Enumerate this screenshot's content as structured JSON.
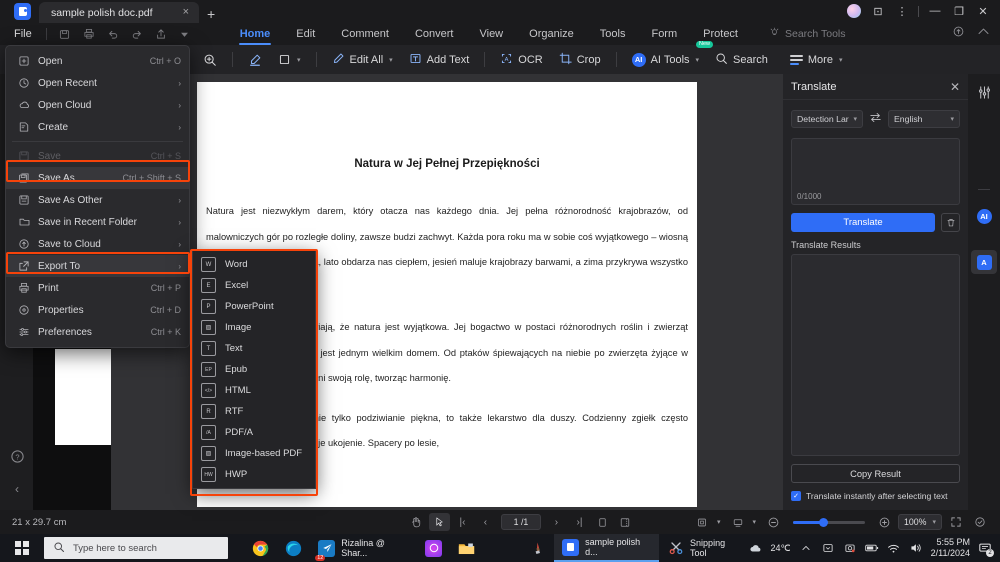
{
  "titlebar": {
    "tab_label": "sample polish doc.pdf",
    "close_icon": "×",
    "new_tab_icon": "+",
    "screen_icon": "⊡",
    "more_icon": "⋮",
    "minimize_icon": "—",
    "maximize_icon": "❐",
    "window_close_icon": "✕"
  },
  "menubar": {
    "file_label": "File",
    "quick_icons": [
      "save-icon",
      "print-icon",
      "undo-icon",
      "redo-icon",
      "share-icon",
      "chevron-down-icon"
    ],
    "tabs": [
      {
        "label": "Home",
        "active": true
      },
      {
        "label": "Edit",
        "active": false
      },
      {
        "label": "Comment",
        "active": false
      },
      {
        "label": "Convert",
        "active": false
      },
      {
        "label": "View",
        "active": false
      },
      {
        "label": "Organize",
        "active": false
      },
      {
        "label": "Tools",
        "active": false
      },
      {
        "label": "Form",
        "active": false
      },
      {
        "label": "Protect",
        "active": false
      }
    ],
    "search_tools_label": "Search Tools",
    "search_tools_icon": "bulb-icon",
    "right_icons": [
      "cloud-upload-icon",
      "collapse-ribbon-icon"
    ]
  },
  "toolbar": {
    "zoom_select_icon": "magnifier-plus-icon",
    "highlight_icon": "highlight-icon",
    "shape_icon": "square-icon",
    "edit_all_label": "Edit All",
    "add_text_label": "Add Text",
    "ocr_label": "OCR",
    "crop_label": "Crop",
    "ai_tools_label": "AI Tools",
    "ai_tools_badge": "New",
    "ai_badge_letters": "AI",
    "search_label": "Search",
    "more_label": "More"
  },
  "file_menu": {
    "items": [
      {
        "label": "Open",
        "accel": "Ctrl + O",
        "icon": "plus-box-icon",
        "arrow": false,
        "disabled": false,
        "highlight": false
      },
      {
        "label": "Open Recent",
        "accel": "",
        "icon": "clock-icon",
        "arrow": true,
        "disabled": false,
        "highlight": false
      },
      {
        "label": "Open Cloud",
        "accel": "",
        "icon": "cloud-icon",
        "arrow": true,
        "disabled": false,
        "highlight": false
      },
      {
        "label": "Create",
        "accel": "",
        "icon": "create-doc-icon",
        "arrow": true,
        "disabled": false,
        "highlight": false
      },
      {
        "label": "Save",
        "accel": "Ctrl + S",
        "icon": "floppy-icon",
        "arrow": false,
        "disabled": true,
        "highlight": false
      },
      {
        "label": "Save As",
        "accel": "Ctrl + Shift + S",
        "icon": "save-as-icon",
        "arrow": false,
        "disabled": false,
        "highlight": true
      },
      {
        "label": "Save As Other",
        "accel": "",
        "icon": "floppy-stack-icon",
        "arrow": true,
        "disabled": false,
        "highlight": false
      },
      {
        "label": "Save in Recent Folder",
        "accel": "",
        "icon": "folder-icon",
        "arrow": true,
        "disabled": false,
        "highlight": false
      },
      {
        "label": "Save to Cloud",
        "accel": "",
        "icon": "cloud-upload-icon",
        "arrow": true,
        "disabled": false,
        "highlight": false
      },
      {
        "label": "Export To",
        "accel": "",
        "icon": "export-icon",
        "arrow": true,
        "disabled": false,
        "highlight": true
      },
      {
        "label": "Print",
        "accel": "Ctrl + P",
        "icon": "printer-icon",
        "arrow": false,
        "disabled": false,
        "highlight": false
      },
      {
        "label": "Properties",
        "accel": "Ctrl + D",
        "icon": "info-circle-icon",
        "arrow": false,
        "disabled": false,
        "highlight": false
      },
      {
        "label": "Preferences",
        "accel": "Ctrl + K",
        "icon": "sliders-icon",
        "arrow": false,
        "disabled": false,
        "highlight": false
      }
    ]
  },
  "export_submenu": {
    "items": [
      {
        "label": "Word",
        "icon": "word-file-icon",
        "glyph": "W"
      },
      {
        "label": "Excel",
        "icon": "excel-file-icon",
        "glyph": "E"
      },
      {
        "label": "PowerPoint",
        "icon": "powerpoint-file-icon",
        "glyph": "P"
      },
      {
        "label": "Image",
        "icon": "image-file-icon",
        "glyph": "▨"
      },
      {
        "label": "Text",
        "icon": "text-file-icon",
        "glyph": "T"
      },
      {
        "label": "Epub",
        "icon": "epub-file-icon",
        "glyph": "EP"
      },
      {
        "label": "HTML",
        "icon": "html-file-icon",
        "glyph": "</>"
      },
      {
        "label": "RTF",
        "icon": "rtf-file-icon",
        "glyph": "R"
      },
      {
        "label": "PDF/A",
        "icon": "pdfa-file-icon",
        "glyph": "/A"
      },
      {
        "label": "Image-based PDF",
        "icon": "image-pdf-file-icon",
        "glyph": "▨"
      },
      {
        "label": "HWP",
        "icon": "hwp-file-icon",
        "glyph": "HW"
      }
    ]
  },
  "document": {
    "title": "Natura w Jej Pełnej Przepiękności",
    "paragraphs": [
      "Natura jest niezwykłym darem, który otacza nas każdego dnia. Jej pełna różnorodność krajobrazów, od malowniczych gór po rozległe doliny, zawsze budzi zachwyt. Każda pora roku ma w sobie coś wyjątkowego – wiosną przyroda budzi się do życia, lato obdarza nas ciepłem, jesień maluje krajobrazy barwami, a zima przykrywa wszystko białym puchem.",
      "Wszystkie te cechy sprawiają, że natura jest wyjątkowa. Jej bogactwo w postaci różnorodnych roślin i zwierząt sprawia, że nasza planeta jest jednym wielkim domem. Od ptaków śpiewających na niebie po zwierzęta żyjące w lasach – każdy gatunek pełni swoją rolę, tworząc harmonię.",
      "Obcowanie z naturą to nie tylko podziwianie piękna, to także lekarstwo dla duszy. Codzienny zgiełk często przytłacza, ale natura oferuje ukojenie. Spacery po lesie,"
    ]
  },
  "translate_panel": {
    "title": "Translate",
    "close_icon": "✕",
    "source_language": "Detection Lar",
    "swap_icon": "swap-horizontal-icon",
    "target_language": "English",
    "char_count": "0/1000",
    "translate_button": "Translate",
    "clear_icon": "trash-icon",
    "results_label": "Translate Results",
    "copy_button": "Copy Result",
    "checkbox_label": "Translate instantly after selecting text",
    "checkbox_checked": true,
    "check_glyph": "✓"
  },
  "right_rail": {
    "items": [
      {
        "icon": "sliders-icon",
        "label": "",
        "selected": false
      },
      {
        "icon": "ai-circle-icon",
        "label": "AI",
        "selected": false
      },
      {
        "icon": "translate-icon",
        "label": "A",
        "selected": true
      }
    ],
    "collapse_icon": "›"
  },
  "left_rail": {
    "help_icon": "?",
    "collapse_icon": "‹"
  },
  "statusbar": {
    "page_size": "21 x 29.7 cm",
    "hand_icon": "hand-icon",
    "select-icon": "select-text-icon",
    "first_page_icon": "|‹",
    "prev_page_icon": "‹",
    "page_indicator": "1 /1",
    "next_page_icon": "›",
    "last_page_icon": "›|",
    "single_page_icon": "□",
    "facing_page_icon": "▭",
    "view_mode_icon": "page-view-icon",
    "layout_icon": "layout-icon",
    "zoom_out_icon": "⊖",
    "zoom_in_icon": "⊕",
    "zoom_level": "100%",
    "fullscreen_icon": "⛶",
    "fit_icon": "⊙"
  },
  "taskbar": {
    "start_icon": "windows-icon",
    "search_placeholder": "Type here to search",
    "search_icon": "search-icon",
    "apps": [
      {
        "name": "chrome-icon",
        "label": "",
        "active": false
      },
      {
        "name": "edge-icon",
        "label": "",
        "active": false
      },
      {
        "name": "mail-icon",
        "label": "Rizalina @ Shar...",
        "active": false,
        "badge": "12"
      },
      {
        "name": "office-icon",
        "label": "",
        "active": false
      },
      {
        "name": "file-explorer-icon",
        "label": "",
        "active": false
      },
      {
        "name": "paint-icon",
        "label": "",
        "active": false
      },
      {
        "name": "pdf-app-icon",
        "label": "sample polish d...",
        "active": true
      },
      {
        "name": "snipping-tool-icon",
        "label": "Snipping Tool",
        "active": false
      }
    ],
    "weather": "24℃",
    "weather_icon": "cloud-icon",
    "tray_icons": [
      "chevron-up-icon",
      "onedrive-icon",
      "camera-icon",
      "battery-icon",
      "wifi-icon",
      "volume-icon"
    ],
    "time": "5:55 PM",
    "date": "2/11/2024",
    "notification_icon": "notification-icon",
    "notification_count": "2"
  },
  "colors": {
    "accent": "#2f6df6",
    "highlight_border": "#f6430a",
    "app_bg": "#1c1c1e",
    "panel_bg": "#242427"
  }
}
